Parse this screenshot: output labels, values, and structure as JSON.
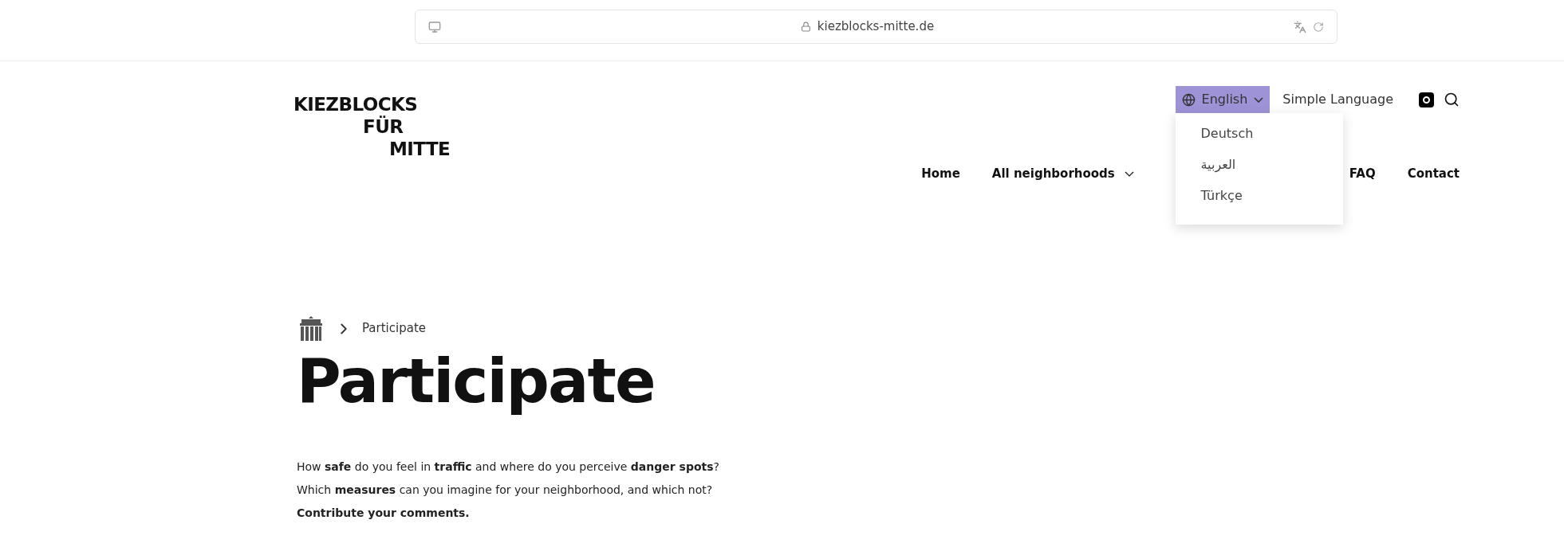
{
  "browser": {
    "url": "kiezblocks-mitte.de"
  },
  "logo": {
    "lines": [
      "KIEZBLOCKS",
      "FÜR",
      "MITTE"
    ]
  },
  "language_menu": {
    "current": "English",
    "expanded": true,
    "options": [
      "Deutsch",
      "العربية",
      "Türkçe"
    ]
  },
  "simple_language": "Simple Language",
  "nav": [
    {
      "label": "Home",
      "has_dropdown": false
    },
    {
      "label": "All neighborhoods",
      "has_dropdown": true
    },
    {
      "label": "FAQ",
      "has_dropdown": false
    },
    {
      "label": "Contact",
      "has_dropdown": false
    }
  ],
  "breadcrumb": {
    "current": "Participate"
  },
  "title": "Participate",
  "intro": [
    "How **safe** do you feel in **traffic** and where do you perceive **danger spots**?",
    "Which **measures** can you imagine for your neighborhood, and which not?",
    "**Contribute your comments.**"
  ]
}
